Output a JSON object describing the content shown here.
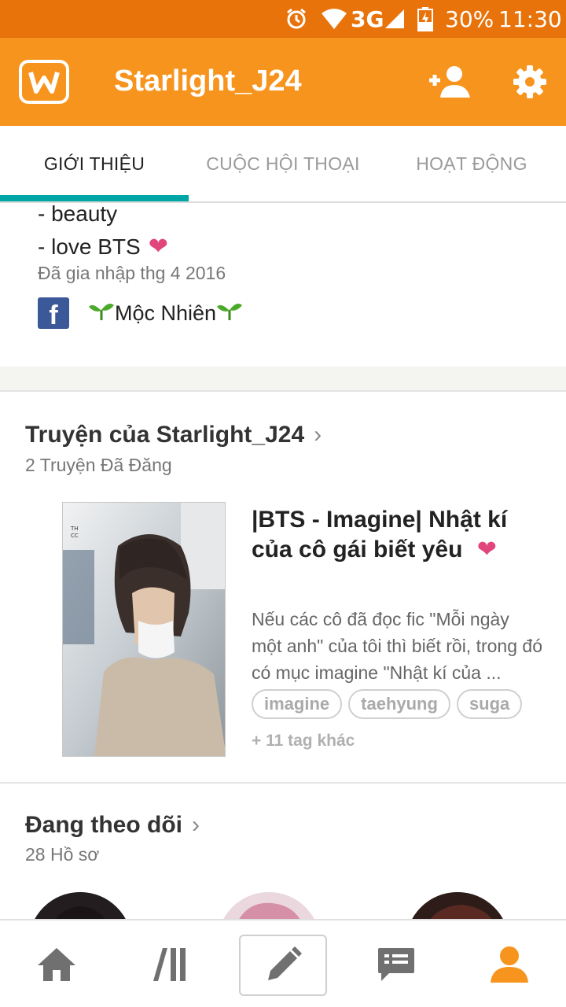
{
  "status_bar": {
    "network": "3G",
    "battery": "30%",
    "time": "11:30",
    "icons": [
      "alarm-icon",
      "wifi-icon",
      "signal-icon",
      "battery-charging-icon"
    ]
  },
  "app_bar": {
    "title": "Starlight_J24",
    "logo_icon": "wattpad-logo",
    "actions": [
      "add-user-icon",
      "gear-icon"
    ],
    "color": "#f7941d"
  },
  "tabs": [
    {
      "label": "GIỚI THIỆU",
      "active": true
    },
    {
      "label": "CUỘC HỘI THOẠI",
      "active": false
    },
    {
      "label": "HOẠT ĐỘNG",
      "active": false
    }
  ],
  "accent_color": "#00a6a6",
  "about": {
    "line1": "- beauty",
    "line2": "- love BTS",
    "heart": "❤",
    "joined": "Đã gia nhập thg 4 2016",
    "facebook_letter": "f",
    "facebook_name": "Mộc Nhiên"
  },
  "stories": {
    "title": "Truyện của Starlight_J24",
    "count": "2 Truyện Đã Đăng",
    "item": {
      "title": "|BTS - Imagine| Nhật kí của cô gái biết yêu",
      "heart": "❤",
      "description": "Nếu các cô đã đọc fic \"Mỗi ngày một anh\" của tôi thì biết rồi, trong đó có mục imagine \"Nhật kí của ...",
      "tags": [
        "imagine",
        "taehyung",
        "suga"
      ],
      "more_tags": "+ 11 tag khác"
    }
  },
  "following": {
    "title": "Đang theo dõi",
    "count": "28 Hồ sơ"
  },
  "bottom_nav": [
    "home-icon",
    "library-icon",
    "pencil-icon",
    "messages-icon",
    "profile-icon"
  ],
  "chevron": "›"
}
